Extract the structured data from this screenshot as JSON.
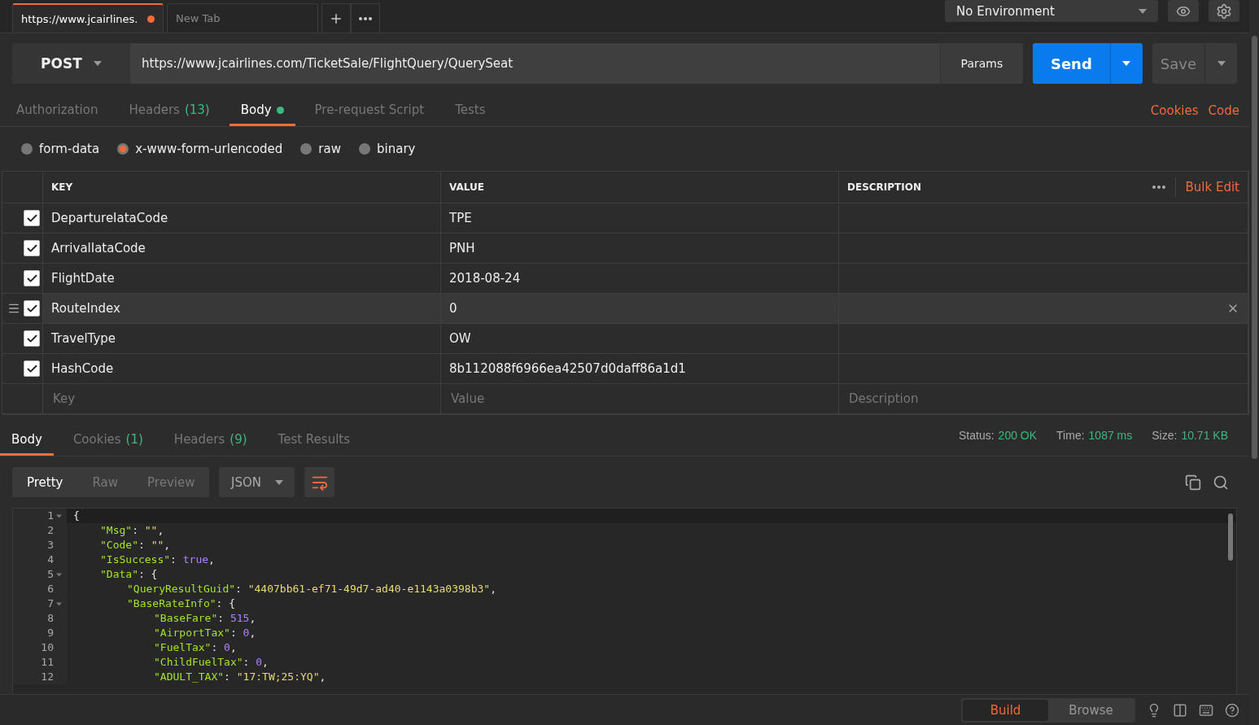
{
  "tabs": [
    {
      "label": "https://www.jcairlines.",
      "selected": true,
      "unsaved": true
    },
    {
      "label": "New Tab",
      "selected": false,
      "unsaved": false
    }
  ],
  "environment": {
    "value": "No Environment"
  },
  "request": {
    "method": "POST",
    "url": "https://www.jcairlines.com/TicketSale/FlightQuery/QuerySeat",
    "params": "Params",
    "send": "Send",
    "save": "Save"
  },
  "request_tabs": [
    {
      "label": "Authorization",
      "selected": false,
      "dot": false
    },
    {
      "label": "Headers",
      "count": "(13)",
      "selected": false,
      "dot": false
    },
    {
      "label": "Body",
      "selected": true,
      "dot": true
    },
    {
      "label": "Pre-request Script",
      "selected": false,
      "dot": false
    },
    {
      "label": "Tests",
      "selected": false,
      "dot": false
    }
  ],
  "request_links": [
    "Cookies",
    "Code"
  ],
  "body_types": [
    {
      "label": "form-data",
      "selected": false
    },
    {
      "label": "x-www-form-urlencoded",
      "selected": true
    },
    {
      "label": "raw",
      "selected": false
    },
    {
      "label": "binary",
      "selected": false
    }
  ],
  "table": {
    "columns": [
      "KEY",
      "VALUE",
      "DESCRIPTION"
    ],
    "bulk_edit": "Bulk Edit",
    "rows": [
      {
        "key": "DepartureIataCode",
        "value": "TPE",
        "checked": true,
        "hovered": false
      },
      {
        "key": "ArrivalIataCode",
        "value": "PNH",
        "checked": true,
        "hovered": false
      },
      {
        "key": "FlightDate",
        "value": "2018-08-24",
        "checked": true,
        "hovered": false
      },
      {
        "key": "RouteIndex",
        "value": "0",
        "checked": true,
        "hovered": true
      },
      {
        "key": "TravelType",
        "value": "OW",
        "checked": true,
        "hovered": false
      },
      {
        "key": "HashCode",
        "value": "8b112088f6966ea42507d0daff86a1d1",
        "checked": true,
        "hovered": false
      }
    ],
    "new_row": {
      "key_placeholder": "Key",
      "value_placeholder": "Value",
      "description_placeholder": "Description"
    }
  },
  "response_tabs": [
    {
      "label": "Body",
      "selected": true
    },
    {
      "label": "Cookies",
      "count": "(1)",
      "selected": false
    },
    {
      "label": "Headers",
      "count": "(9)",
      "selected": false
    },
    {
      "label": "Test Results",
      "selected": false
    }
  ],
  "response_meta": [
    {
      "label": "Status:",
      "value": "200 OK"
    },
    {
      "label": "Time:",
      "value": "1087 ms"
    },
    {
      "label": "Size:",
      "value": "10.71 KB"
    }
  ],
  "view_modes": [
    {
      "label": "Pretty",
      "selected": true
    },
    {
      "label": "Raw",
      "selected": false
    },
    {
      "label": "Preview",
      "selected": false
    }
  ],
  "format": "JSON",
  "code_lines": [
    {
      "number": "1",
      "tokens": [
        {
          "kind": "punct",
          "text": "{"
        }
      ],
      "children": [
        {
          "number": "2",
          "tokens": [
            {
              "kind": "key",
              "text": "\"Msg\""
            },
            {
              "kind": "punct",
              "text": ": "
            },
            {
              "kind": "string",
              "text": "\"\""
            },
            {
              "kind": "punct",
              "text": ","
            }
          ]
        },
        {
          "number": "3",
          "tokens": [
            {
              "kind": "key",
              "text": "\"Code\""
            },
            {
              "kind": "punct",
              "text": ": "
            },
            {
              "kind": "string",
              "text": "\"\""
            },
            {
              "kind": "punct",
              "text": ","
            }
          ]
        },
        {
          "number": "4",
          "tokens": [
            {
              "kind": "key",
              "text": "\"IsSuccess\""
            },
            {
              "kind": "punct",
              "text": ": "
            },
            {
              "kind": "literal",
              "text": "true"
            },
            {
              "kind": "punct",
              "text": ","
            }
          ]
        },
        {
          "number": "5",
          "tokens": [
            {
              "kind": "key",
              "text": "\"Data\""
            },
            {
              "kind": "punct",
              "text": ": {"
            }
          ],
          "children": [
            {
              "number": "6",
              "tokens": [
                {
                  "kind": "key",
                  "text": "\"QueryResultGuid\""
                },
                {
                  "kind": "punct",
                  "text": ": "
                },
                {
                  "kind": "string",
                  "text": "\"4407bb61-ef71-49d7-ad40-e1143a0398b3\""
                },
                {
                  "kind": "punct",
                  "text": ","
                }
              ]
            },
            {
              "number": "7",
              "tokens": [
                {
                  "kind": "key",
                  "text": "\"BaseRateInfo\""
                },
                {
                  "kind": "punct",
                  "text": ": {"
                }
              ],
              "children": [
                {
                  "number": "8",
                  "tokens": [
                    {
                      "kind": "key",
                      "text": "\"BaseFare\""
                    },
                    {
                      "kind": "punct",
                      "text": ": "
                    },
                    {
                      "kind": "literal",
                      "text": "515"
                    },
                    {
                      "kind": "punct",
                      "text": ","
                    }
                  ]
                },
                {
                  "number": "9",
                  "tokens": [
                    {
                      "kind": "key",
                      "text": "\"AirportTax\""
                    },
                    {
                      "kind": "punct",
                      "text": ": "
                    },
                    {
                      "kind": "literal",
                      "text": "0"
                    },
                    {
                      "kind": "punct",
                      "text": ","
                    }
                  ]
                },
                {
                  "number": "10",
                  "tokens": [
                    {
                      "kind": "key",
                      "text": "\"FuelTax\""
                    },
                    {
                      "kind": "punct",
                      "text": ": "
                    },
                    {
                      "kind": "literal",
                      "text": "0"
                    },
                    {
                      "kind": "punct",
                      "text": ","
                    }
                  ]
                },
                {
                  "number": "11",
                  "tokens": [
                    {
                      "kind": "key",
                      "text": "\"ChildFuelTax\""
                    },
                    {
                      "kind": "punct",
                      "text": ": "
                    },
                    {
                      "kind": "literal",
                      "text": "0"
                    },
                    {
                      "kind": "punct",
                      "text": ","
                    }
                  ]
                },
                {
                  "number": "12",
                  "tokens": [
                    {
                      "kind": "key",
                      "text": "\"ADULT_TAX\""
                    },
                    {
                      "kind": "punct",
                      "text": ": "
                    },
                    {
                      "kind": "string",
                      "text": "\"17:TW;25:YQ\""
                    },
                    {
                      "kind": "punct",
                      "text": ","
                    }
                  ]
                }
              ]
            }
          ]
        }
      ]
    }
  ],
  "footer_modes": [
    {
      "label": "Build",
      "selected": true
    },
    {
      "label": "Browse",
      "selected": false
    }
  ]
}
